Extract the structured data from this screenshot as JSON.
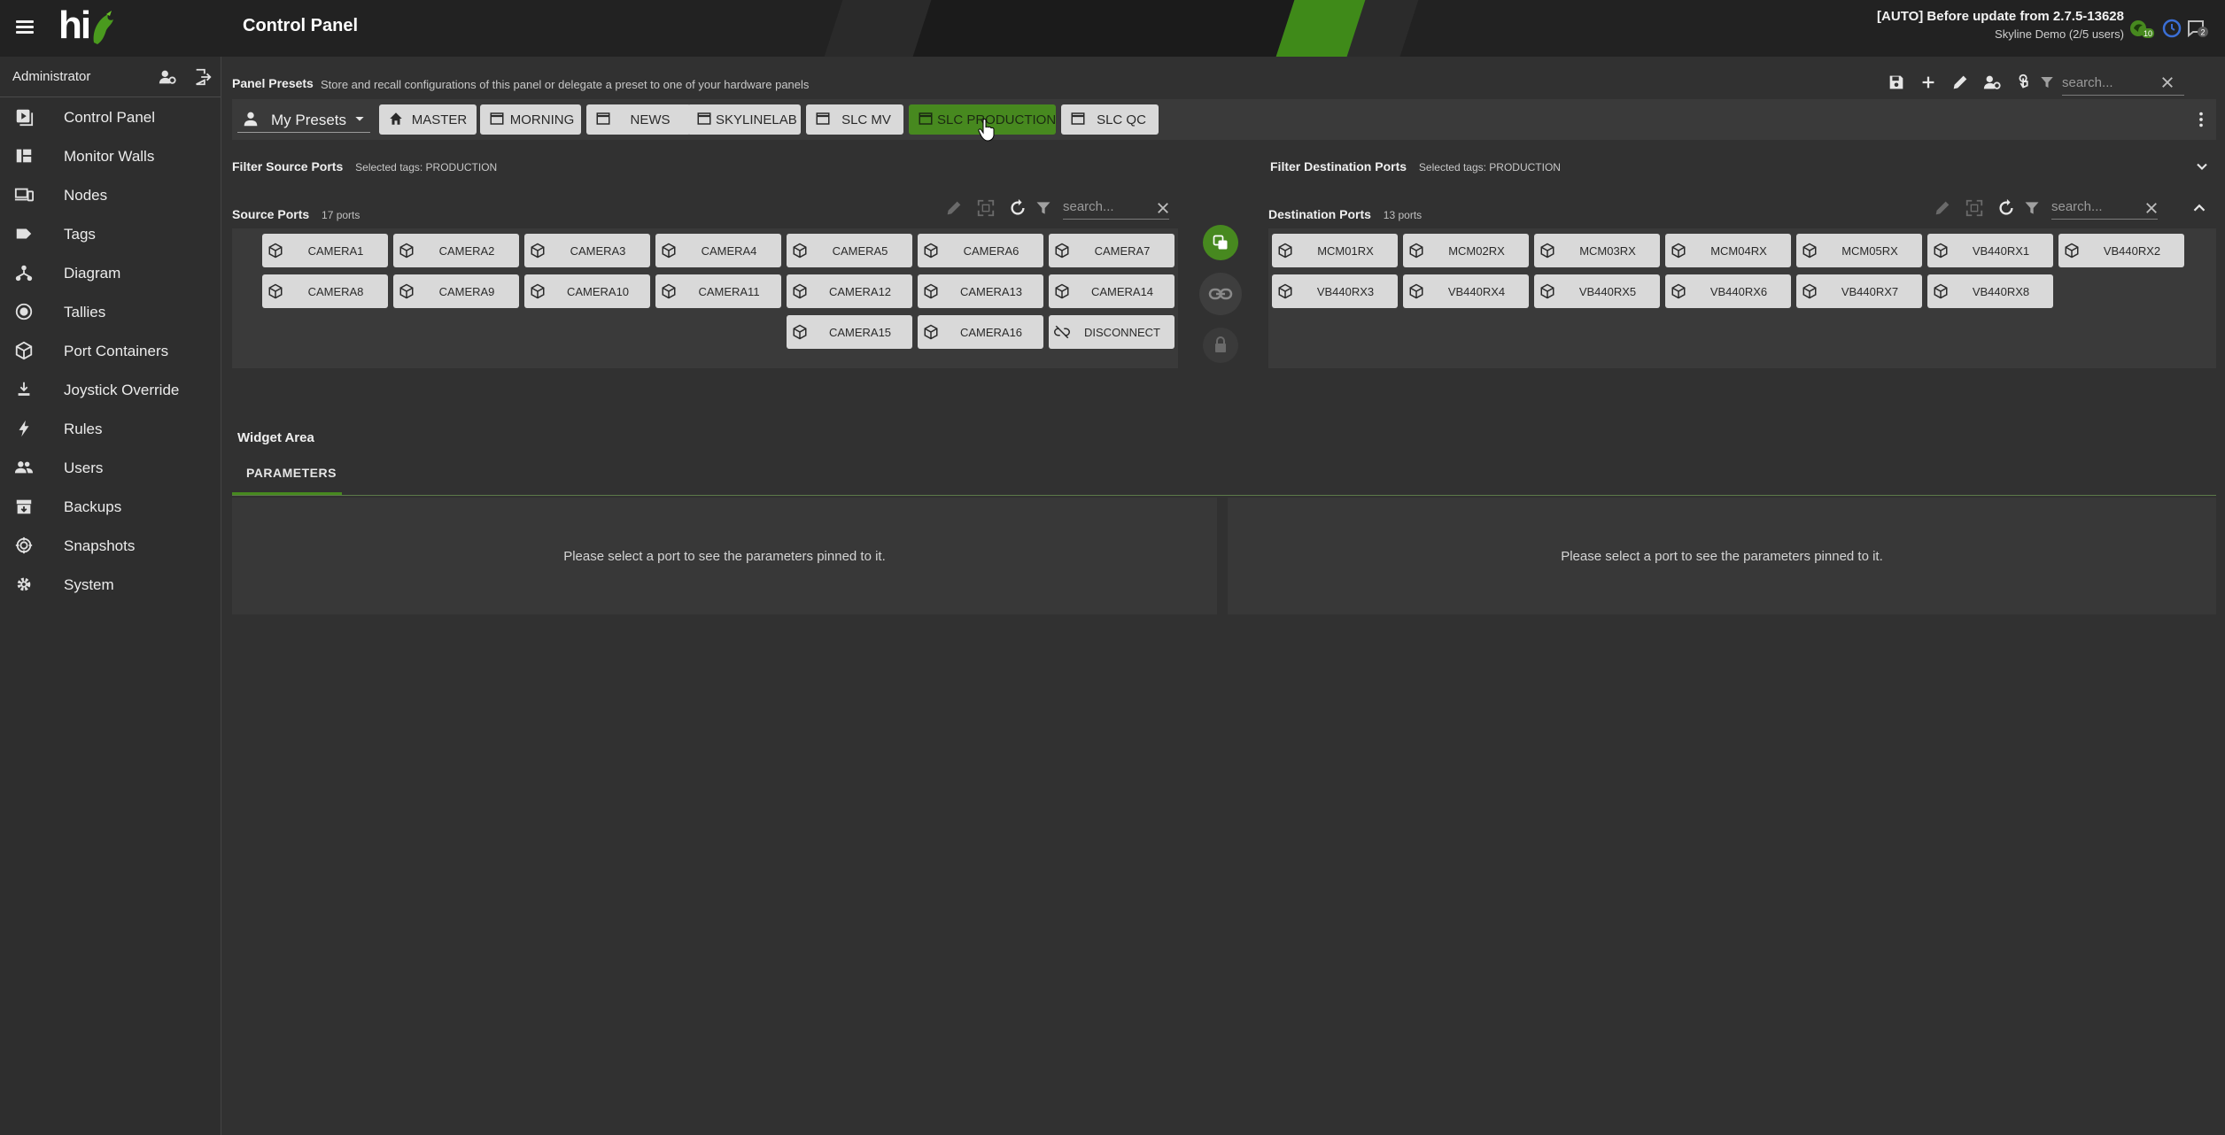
{
  "header": {
    "title": "Control Panel",
    "logo_text": "hi",
    "update_line1": "[AUTO] Before update from 2.7.5-13628",
    "update_line2": "Skyline Demo (2/5 users)",
    "badge_count": "10",
    "chat_count": "2"
  },
  "sidebar": {
    "user": "Administrator",
    "items": [
      {
        "label": "Control Panel",
        "icon": "control-panel-icon"
      },
      {
        "label": "Monitor Walls",
        "icon": "monitor-walls-icon"
      },
      {
        "label": "Nodes",
        "icon": "nodes-icon"
      },
      {
        "label": "Tags",
        "icon": "tag-icon"
      },
      {
        "label": "Diagram",
        "icon": "diagram-icon"
      },
      {
        "label": "Tallies",
        "icon": "tallies-icon"
      },
      {
        "label": "Port Containers",
        "icon": "cube-icon"
      },
      {
        "label": "Joystick Override",
        "icon": "joystick-icon"
      },
      {
        "label": "Rules",
        "icon": "bolt-icon"
      },
      {
        "label": "Users",
        "icon": "users-icon"
      },
      {
        "label": "Backups",
        "icon": "backup-icon"
      },
      {
        "label": "Snapshots",
        "icon": "snapshot-icon"
      },
      {
        "label": "System",
        "icon": "gear-icon"
      }
    ]
  },
  "presets": {
    "title": "Panel Presets",
    "description": "Store and recall configurations of this panel or delegate a preset to one of your hardware panels",
    "search_placeholder": "search...",
    "dropdown_label": "My Presets",
    "buttons": [
      {
        "label": "MASTER",
        "icon": "home-icon"
      },
      {
        "label": "MORNING",
        "icon": "window-icon"
      },
      {
        "label": "NEWS",
        "icon": "window-icon"
      },
      {
        "label": "SKYLINELAB",
        "icon": "window-icon"
      },
      {
        "label": "SLC MV",
        "icon": "window-icon"
      },
      {
        "label": "SLC PRODUCTION",
        "icon": "window-icon",
        "active": true
      },
      {
        "label": "SLC QC",
        "icon": "window-icon"
      }
    ]
  },
  "filters": {
    "source_title": "Filter Source Ports",
    "source_tags": "Selected tags: PRODUCTION",
    "dest_title": "Filter Destination Ports",
    "dest_tags": "Selected tags: PRODUCTION"
  },
  "source_ports": {
    "title": "Source Ports",
    "count": "17 ports",
    "search_placeholder": "search...",
    "items": [
      "CAMERA1",
      "CAMERA2",
      "CAMERA3",
      "CAMERA4",
      "CAMERA5",
      "CAMERA6",
      "CAMERA7",
      "CAMERA8",
      "CAMERA9",
      "CAMERA10",
      "CAMERA11",
      "CAMERA12",
      "CAMERA13",
      "CAMERA14",
      "CAMERA15",
      "CAMERA16",
      "DISCONNECT"
    ]
  },
  "dest_ports": {
    "title": "Destination Ports",
    "count": "13 ports",
    "search_placeholder": "search...",
    "items": [
      "MCM01RX",
      "MCM02RX",
      "MCM03RX",
      "MCM04RX",
      "MCM05RX",
      "VB440RX1",
      "VB440RX2",
      "VB440RX3",
      "VB440RX4",
      "VB440RX5",
      "VB440RX6",
      "VB440RX7",
      "VB440RX8"
    ]
  },
  "widget": {
    "title": "Widget Area",
    "tab": "PARAMETERS",
    "empty_left": "Please select a port to see the parameters pinned to it.",
    "empty_right": "Please select a port to see the parameters pinned to it."
  },
  "colors": {
    "accent": "#47891f",
    "background": "#313131",
    "topbar": "#222222",
    "button": "#d9d9d9"
  }
}
